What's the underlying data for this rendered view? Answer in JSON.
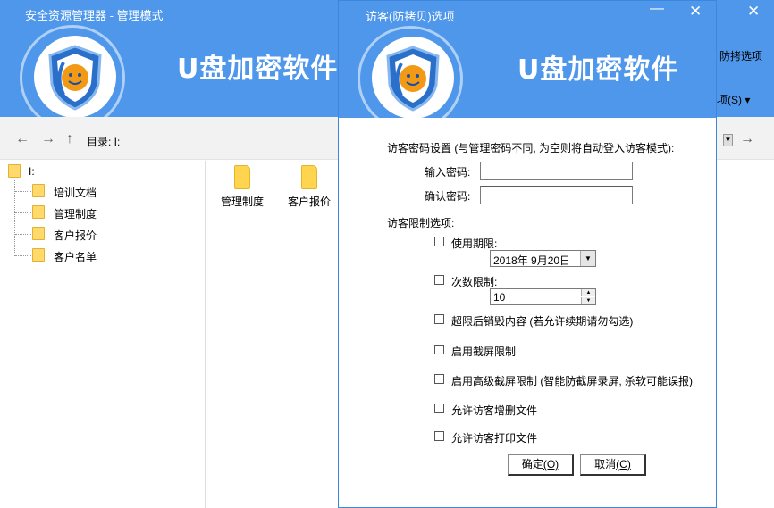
{
  "main_window": {
    "title": "安全资源管理器 - 管理模式",
    "brand": "U盘加密软件",
    "menu_fangkaobei": "防拷选项",
    "menu_options": "项(S) ▾",
    "close_glyph": "✕",
    "nav": {
      "back": "←",
      "forward": "→",
      "up": "↑",
      "dir_label": "目录:  I:",
      "go": "→"
    },
    "tree": {
      "root": "I:",
      "items": [
        {
          "label": "培训文档"
        },
        {
          "label": "管理制度"
        },
        {
          "label": "客户报价"
        },
        {
          "label": "客户名单"
        }
      ]
    },
    "files": [
      {
        "label": "管理制度"
      },
      {
        "label": "客户报价"
      }
    ]
  },
  "dialog": {
    "title": "访客(防拷贝)选项",
    "min_glyph": "—",
    "close_glyph": "✕",
    "brand": "U盘加密软件",
    "password_section": "访客密码设置 (与管理密码不同, 为空则将自动登入访客模式):",
    "password_label": "输入密码:",
    "password_value": "",
    "confirm_label": "确认密码:",
    "confirm_value": "",
    "restrict_section": "访客限制选项:",
    "use_period_label": "使用期限:",
    "use_period_date": "2018年  9月20日",
    "count_limit_label": "次数限制:",
    "count_limit_value": "10",
    "options": [
      {
        "label": "超限后销毁内容 (若允许续期请勿勾选)",
        "checked": false
      },
      {
        "label": "启用截屏限制",
        "checked": false
      },
      {
        "label": "启用高级截屏限制 (智能防截屏录屏, 杀软可能误报)",
        "checked": false
      },
      {
        "label": "允许访客增删文件",
        "checked": false
      },
      {
        "label": "允许访客打印文件",
        "checked": false
      }
    ],
    "use_period_checked": false,
    "count_limit_checked": false,
    "ok_text": "确定",
    "ok_key": "(O)",
    "cancel_text": "取消",
    "cancel_key": "(C)"
  },
  "colors": {
    "header_blue": "#4f97ea",
    "folder_yellow": "#ffd96b"
  }
}
